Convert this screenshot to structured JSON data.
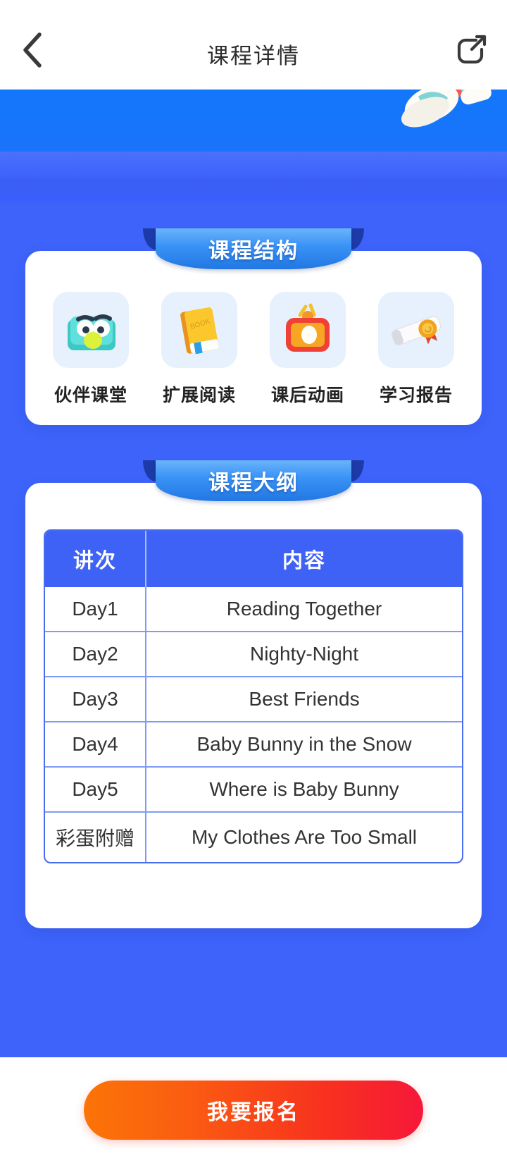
{
  "nav": {
    "back_icon": "chevron-left-icon",
    "title": "课程详情",
    "share_icon": "share-arrow-icon"
  },
  "colors": {
    "page_blue": "#3d63fb",
    "banner_blue": "#1277fb",
    "ribbon_blue": "#2277e2",
    "table_header_blue": "#3e62f5",
    "table_border_blue": "#7f9cf5",
    "cta_gradient_start": "#fb7407",
    "cta_gradient_end": "#f6183a",
    "card_white": "#ffffff",
    "icon_tile_blue": "#e6f1fd"
  },
  "structure_section": {
    "ribbon_title": "课程结构",
    "items": [
      {
        "label": "伙伴课堂",
        "icon": "bird-tablet-icon"
      },
      {
        "label": "扩展阅读",
        "icon": "book-icon"
      },
      {
        "label": "课后动画",
        "icon": "tv-icon"
      },
      {
        "label": "学习报告",
        "icon": "certificate-icon"
      }
    ]
  },
  "outline_section": {
    "ribbon_title": "课程大纲",
    "table": {
      "headers": [
        "讲次",
        "内容"
      ],
      "rows": [
        [
          "Day1",
          "Reading Together"
        ],
        [
          "Day2",
          "Nighty-Night"
        ],
        [
          "Day3",
          "Best Friends"
        ],
        [
          "Day4",
          "Baby Bunny in the Snow"
        ],
        [
          "Day5",
          "Where is Baby Bunny"
        ],
        [
          "彩蛋附赠",
          "My Clothes Are Too Small"
        ]
      ]
    }
  },
  "cta": {
    "label": "我要报名"
  }
}
